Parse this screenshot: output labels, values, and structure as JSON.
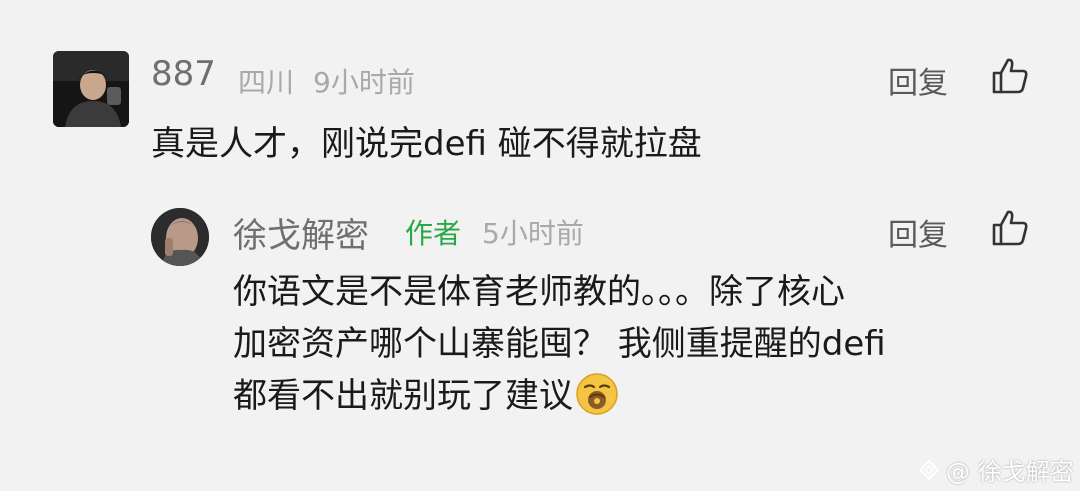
{
  "comment": {
    "username": "887",
    "location": "四川",
    "time": "9小时前",
    "reply_label": "回复",
    "text": "真是人才，刚说完defi 碰不得就拉盘"
  },
  "reply": {
    "username": "徐戈解密",
    "author_badge": "作者",
    "time": "5小时前",
    "reply_label": "回复",
    "text_line1": "你语文是不是体育老师教的。。。除了核心",
    "text_line2": "加密资产哪个山寨能囤？ 我侧重提醒的defi",
    "text_line3": "都看不出就别玩了建议"
  },
  "watermark": {
    "text": "@ 徐戈解密"
  },
  "colors": {
    "background": "#f2f2f2",
    "author_badge": "#2aa846",
    "meta_gray": "#a9a9a9"
  }
}
